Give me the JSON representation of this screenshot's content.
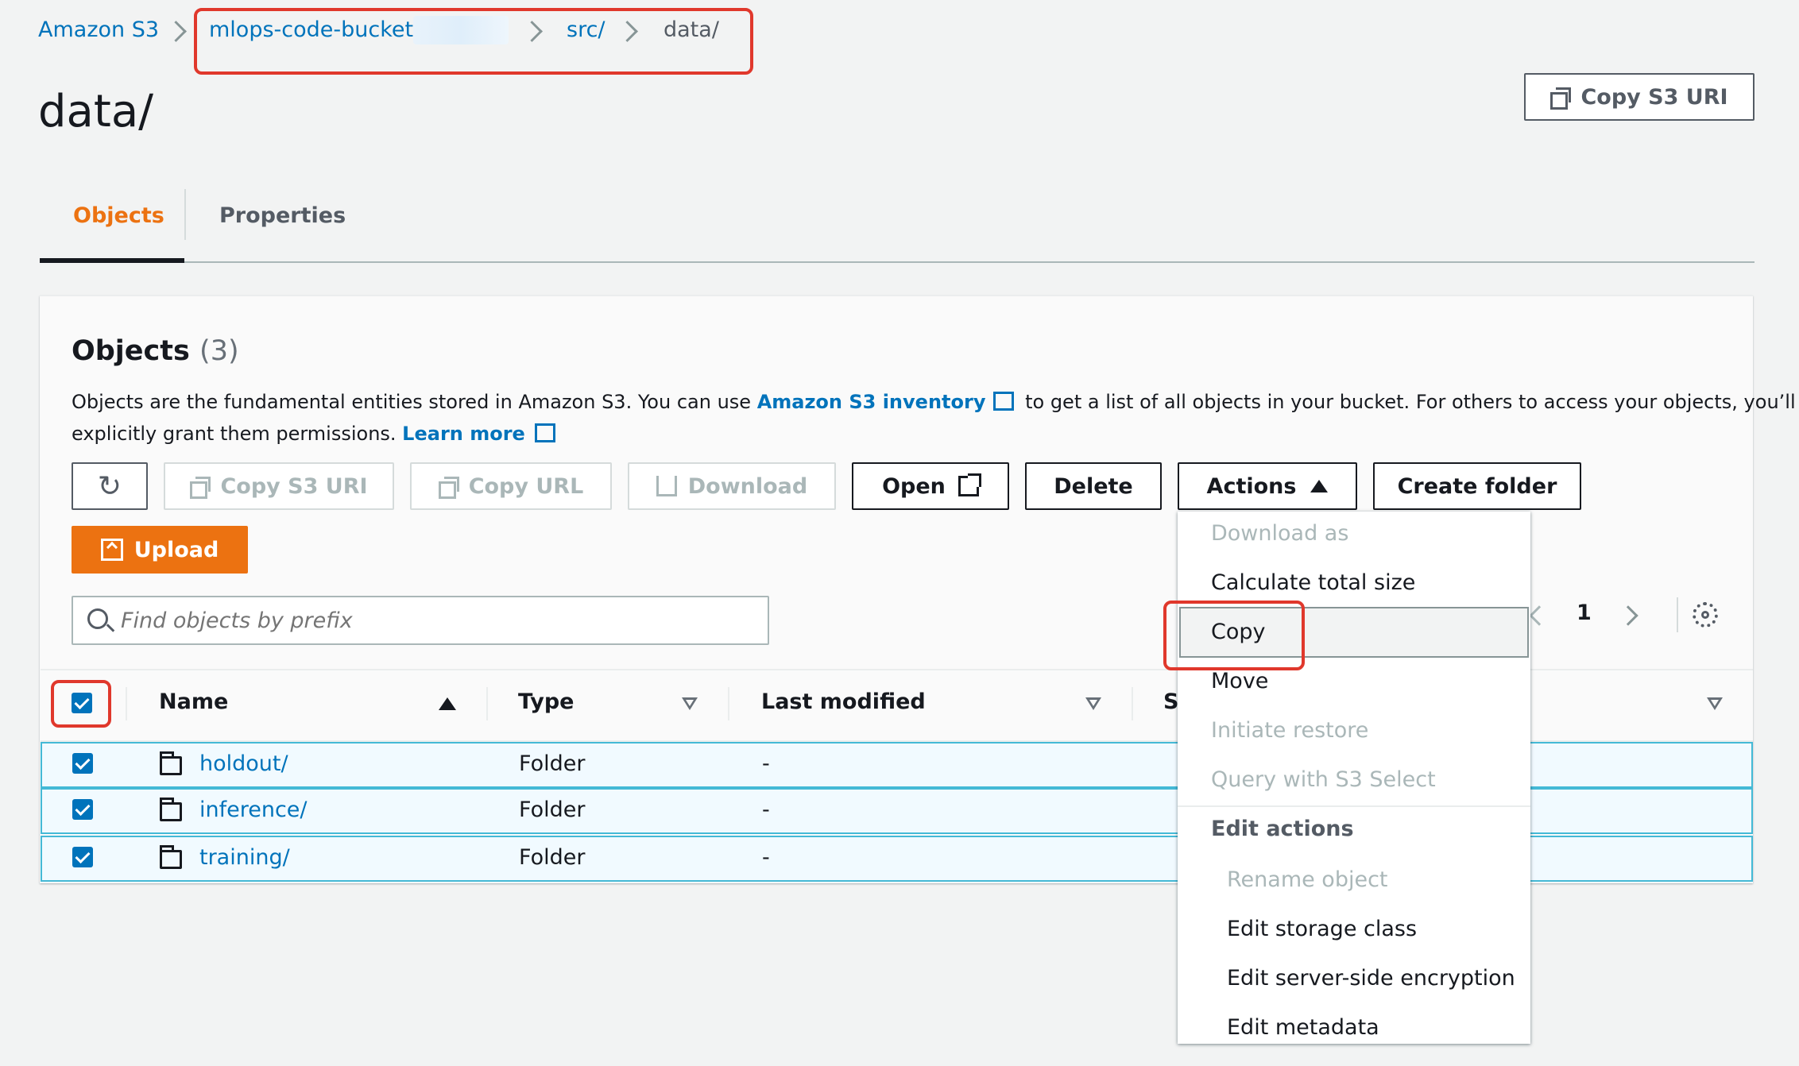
{
  "breadcrumb": {
    "items": [
      "Amazon S3",
      "mlops-code-bucket-",
      "src/",
      "data/"
    ]
  },
  "page": {
    "title": "data/",
    "copy_s3_uri_label": "Copy S3 URI"
  },
  "tabs": [
    {
      "label": "Objects",
      "active": true
    },
    {
      "label": "Properties",
      "active": false
    }
  ],
  "objects_panel": {
    "heading": "Objects",
    "count": "(3)",
    "description_part1": "Objects are the fundamental entities stored in Amazon S3. You can use ",
    "inventory_link": "Amazon S3 inventory",
    "description_part2": " to get a list of all objects in your bucket. For others to access your objects, you’ll need to",
    "description_line2": "explicitly grant them permissions. ",
    "learn_more": "Learn more"
  },
  "toolbar": {
    "copy_s3_uri": "Copy S3 URI",
    "copy_url": "Copy URL",
    "download": "Download",
    "open": "Open",
    "delete": "Delete",
    "actions": "Actions",
    "create_folder": "Create folder",
    "upload": "Upload"
  },
  "search": {
    "placeholder": "Find objects by prefix"
  },
  "pagination": {
    "page": "1"
  },
  "table": {
    "columns": [
      "Name",
      "Type",
      "Last modified",
      "S"
    ],
    "rows": [
      {
        "name": "holdout/",
        "type": "Folder",
        "modified": "-"
      },
      {
        "name": "inference/",
        "type": "Folder",
        "modified": "-"
      },
      {
        "name": "training/",
        "type": "Folder",
        "modified": "-"
      }
    ]
  },
  "actions_menu": {
    "items": [
      {
        "label": "Download as",
        "disabled": true
      },
      {
        "label": "Calculate total size",
        "disabled": false
      },
      {
        "label": "Copy",
        "disabled": false,
        "highlighted": true
      },
      {
        "label": "Move",
        "disabled": false
      },
      {
        "label": "Initiate restore",
        "disabled": true
      },
      {
        "label": "Query with S3 Select",
        "disabled": true
      }
    ],
    "section_title": "Edit actions",
    "sub_items": [
      {
        "label": "Rename object",
        "disabled": true
      },
      {
        "label": "Edit storage class",
        "disabled": false
      },
      {
        "label": "Edit server-side encryption",
        "disabled": false
      },
      {
        "label": "Edit metadata",
        "disabled": false
      }
    ]
  },
  "colors": {
    "link": "#0073bb",
    "primary_orange": "#ec7211",
    "active_tab": "#ec7211",
    "highlight_red": "#e0382c",
    "row_border": "#44b9d6"
  }
}
